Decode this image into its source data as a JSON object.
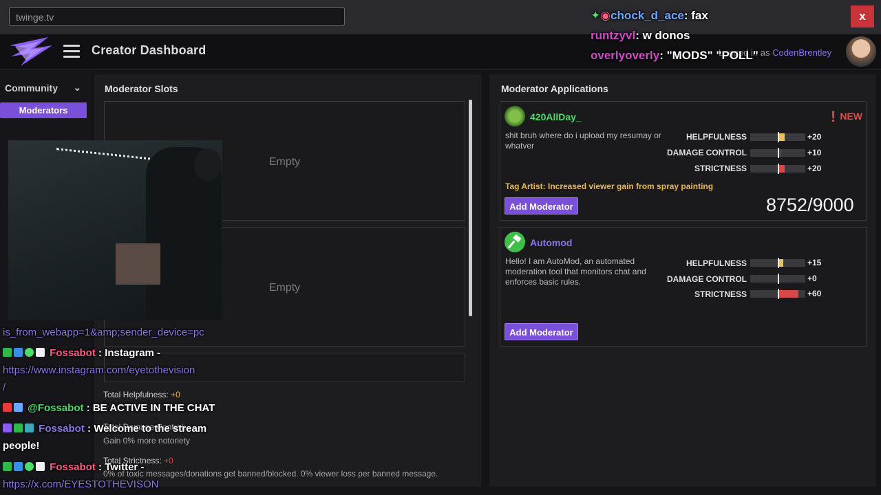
{
  "browser": {
    "url": "twinge.tv",
    "close_label": "x"
  },
  "header": {
    "title": "Creator Dashboard",
    "logged_in_prefix": "Logged in as ",
    "username": "CodenBrentley"
  },
  "sidebar": {
    "section": "Community",
    "active_item": "Moderators"
  },
  "slots": {
    "title": "Moderator Slots",
    "items": [
      "Empty",
      "Empty"
    ],
    "totals": {
      "helpfulness_label": "Total Helpfulness: ",
      "helpfulness_value": "+0",
      "damage_label": "Total Damage Control: ",
      "notoriety": "Gain 0% more notoriety",
      "strictness_label": "Total Strictness: ",
      "strictness_value": "+0",
      "strictness_desc": "0% of toxic messages/donations get banned/blocked. 0% viewer loss per banned message."
    }
  },
  "applications": {
    "title": "Moderator Applications",
    "stat_labels": [
      "HELPFULNESS",
      "DAMAGE CONTROL",
      "STRICTNESS"
    ],
    "items": [
      {
        "name": "420AllDay_",
        "name_color": "#4bdc6a",
        "desc": "shit bruh where do i upload my resumay or whatver",
        "badge": "NEW",
        "stats": [
          {
            "value": "+20",
            "level": 0.25,
            "color": "#e8c25a"
          },
          {
            "value": "+10",
            "level": 0.12,
            "color": "#4a4a4e"
          },
          {
            "value": "+20",
            "level": 0.25,
            "color": "#d84848"
          }
        ],
        "tag": "Tag Artist: Increased viewer gain from spray painting",
        "button": "Add Moderator",
        "score": "8752/9000"
      },
      {
        "name": "Automod",
        "name_color": "#8b73e8",
        "desc": "Hello! I am AutoMod, an automated moderation tool that monitors chat and enforces basic rules.",
        "stats": [
          {
            "value": "+15",
            "level": 0.19,
            "color": "#e8c25a"
          },
          {
            "value": "+0",
            "level": 0.0,
            "color": "#4a4a4e"
          },
          {
            "value": "+60",
            "level": 0.75,
            "color": "#d84848"
          }
        ],
        "button": "Add Moderator"
      }
    ]
  },
  "overlay_chat": {
    "top": [
      {
        "user": "chock_d_ace",
        "msg": ": fax"
      },
      {
        "user": "runtzyvl",
        "msg": ": w donos"
      },
      {
        "user": "overlyoverly",
        "msg": ": \"MODS\" \"POLL\""
      }
    ],
    "bottom": [
      {
        "text": "is_from_webapp=1&amp;sender_device=pc"
      },
      {
        "user": "Fossabot",
        "msg": " : Instagram -"
      },
      {
        "text": "https://www.instagram.com/eyetothevision"
      },
      {
        "text": "/"
      },
      {
        "user": "@Fossabot",
        "msg": " : BE ACTIVE IN THE CHAT"
      },
      {
        "user": "Fossabot",
        "msg": " : Welcome to the stream"
      },
      {
        "text": "people!"
      },
      {
        "user": "Fossabot",
        "msg": " : Twitter -"
      },
      {
        "text": "https://x.com/EYESTOTHEVISON"
      }
    ]
  }
}
